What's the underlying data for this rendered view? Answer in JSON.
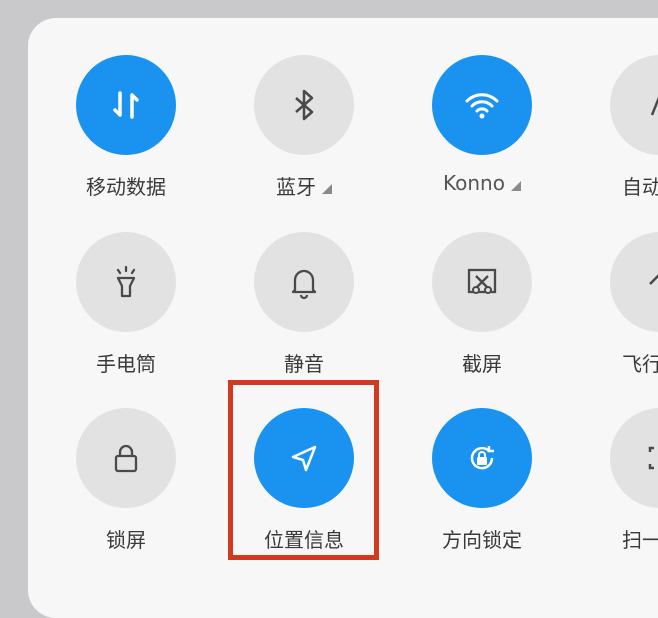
{
  "tiles": [
    {
      "label": "移动数据",
      "icon": "mobile-data-icon",
      "active": true
    },
    {
      "label": "蓝牙",
      "icon": "bluetooth-icon",
      "active": false
    },
    {
      "label": "Konno",
      "icon": "wifi-icon",
      "active": true
    },
    {
      "label": "自动",
      "icon": "auto-brightness-icon",
      "active": false
    },
    {
      "label": "手电筒",
      "icon": "flashlight-icon",
      "active": false
    },
    {
      "label": "静音",
      "icon": "bell-icon",
      "active": false
    },
    {
      "label": "截屏",
      "icon": "screenshot-icon",
      "active": false
    },
    {
      "label": "飞行",
      "icon": "airplane-icon",
      "active": false
    },
    {
      "label": "锁屏",
      "icon": "lock-icon",
      "active": false
    },
    {
      "label": "位置信息",
      "icon": "location-icon",
      "active": true
    },
    {
      "label": "方向锁定",
      "icon": "rotation-lock-icon",
      "active": true
    },
    {
      "label": "扫一",
      "icon": "scan-icon",
      "active": false
    }
  ],
  "colors": {
    "active": "#1a93f0",
    "inactive": "#e2e2e2",
    "highlight": "#d2391e"
  }
}
